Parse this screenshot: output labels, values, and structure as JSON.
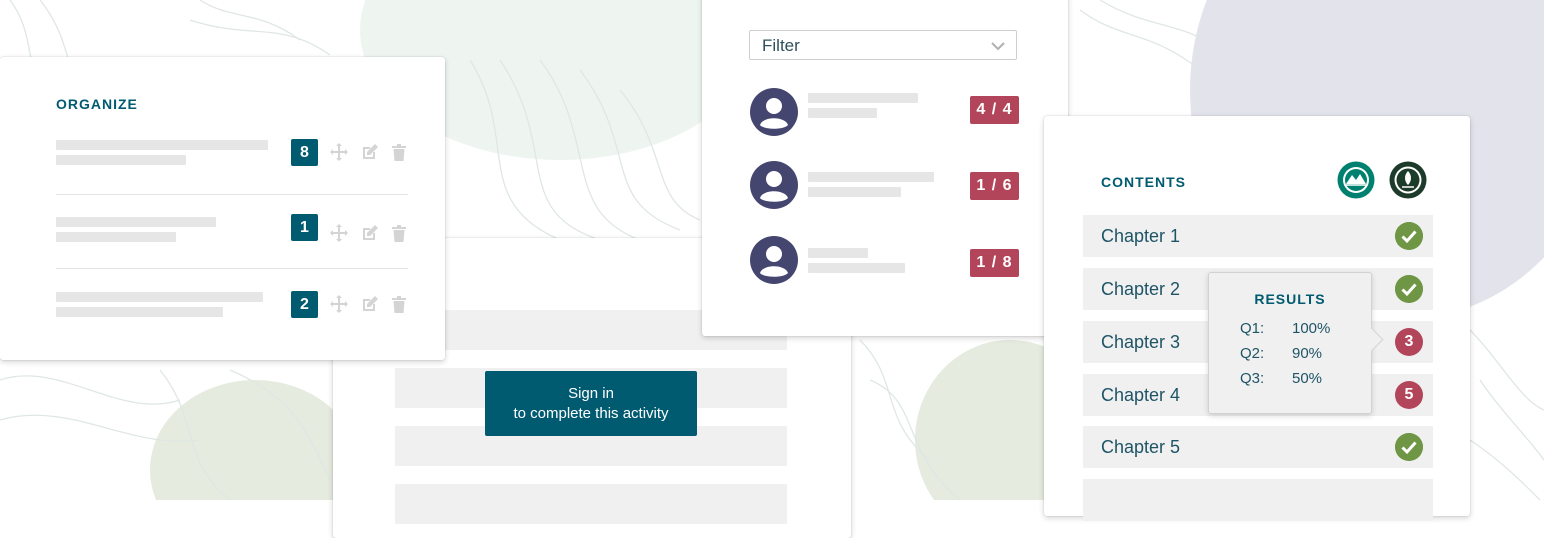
{
  "organize": {
    "title": "ORGANIZE",
    "items": [
      {
        "order": "8"
      },
      {
        "order": "1"
      },
      {
        "order": "2"
      }
    ]
  },
  "signin": {
    "line1": "Sign in",
    "line2": "to complete this activity"
  },
  "filter": {
    "label": "Filter",
    "users": [
      {
        "score": "4 / 4"
      },
      {
        "score": "1 / 6"
      },
      {
        "score": "1 / 8"
      }
    ]
  },
  "contents": {
    "title": "CONTENTS",
    "chapters": [
      {
        "name": "Chapter 1",
        "status": "complete"
      },
      {
        "name": "Chapter 2",
        "status": "complete"
      },
      {
        "name": "Chapter 3",
        "status": "3"
      },
      {
        "name": "Chapter 4",
        "status": "5"
      },
      {
        "name": "Chapter 5",
        "status": "complete"
      }
    ]
  },
  "results": {
    "title": "RESULTS",
    "rows": [
      {
        "q": "Q1:",
        "v": "100%"
      },
      {
        "q": "Q2:",
        "v": "90%"
      },
      {
        "q": "Q3:",
        "v": "50%"
      }
    ]
  },
  "colors": {
    "brand_teal": "#005a70",
    "badge_red": "#b3455a",
    "check_green": "#6e9644",
    "avatar_navy": "#45466f"
  }
}
